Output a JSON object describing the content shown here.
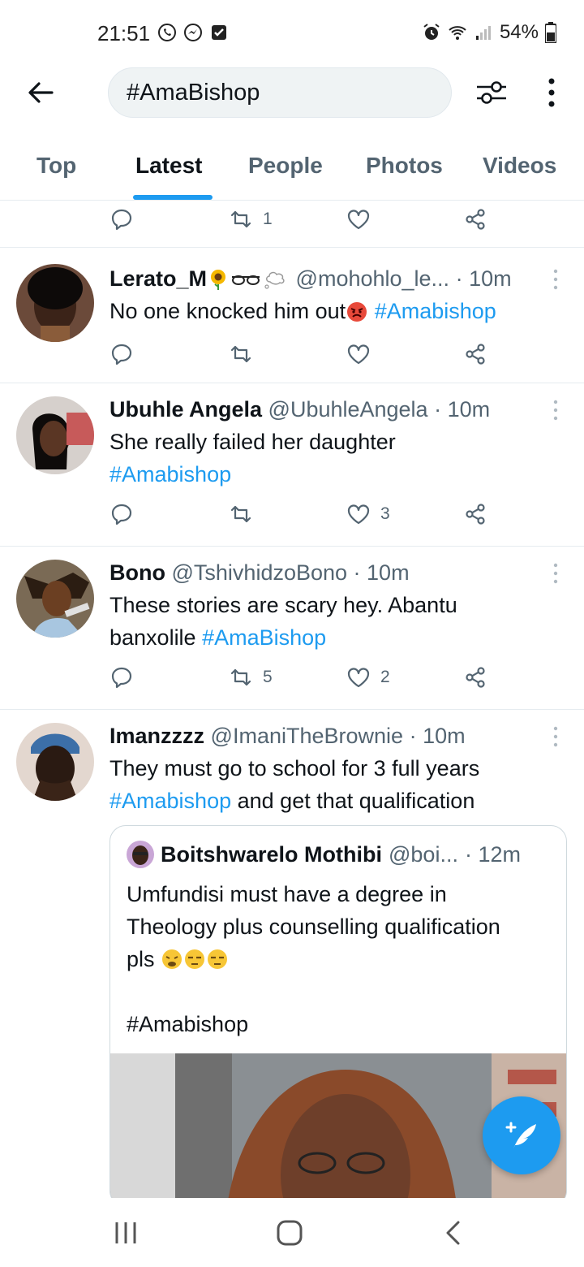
{
  "status_bar": {
    "time": "21:51",
    "battery": "54%"
  },
  "search": {
    "query": "#AmaBishop"
  },
  "tabs": [
    {
      "label": "Top"
    },
    {
      "label": "Latest"
    },
    {
      "label": "People"
    },
    {
      "label": "Photos"
    },
    {
      "label": "Videos"
    }
  ],
  "active_tab": "Latest",
  "top_partial_actions": {
    "retweets": "1"
  },
  "tweets": [
    {
      "name": "Lerato_M",
      "handle": "@mohohlo_le...",
      "time": "· 10m",
      "text": "No one knocked him out",
      "hashtag": "#Amabishop",
      "replies": "",
      "retweets": "",
      "likes": ""
    },
    {
      "name": "Ubuhle Angela",
      "handle": "@UbuhleAngela",
      "time": "· 10m",
      "text": "She really failed her daughter",
      "hashtag": "#Amabishop",
      "replies": "",
      "retweets": "",
      "likes": "3"
    },
    {
      "name": "Bono",
      "handle": "@TshivhidzoBono",
      "time": "· 10m",
      "text_line1": "These stories are scary hey. Abantu",
      "text_line2": "banxolile",
      "hashtag": "#AmaBishop",
      "replies": "",
      "retweets": "5",
      "likes": "2"
    },
    {
      "name": "Imanzzzz",
      "handle": "@ImaniTheBrownie",
      "time": "· 10m",
      "text_line1": "They must go to school for 3 full years",
      "hashtag": "#Amabishop",
      "text_line2": "and get that qualification",
      "quote": {
        "name": "Boitshwarelo Mothibi",
        "handle": "@boi...",
        "time": "· 12m",
        "text_line1": "Umfundisi must have a degree in",
        "text_line2": "Theology plus counselling qualification",
        "text_line3": "pls",
        "hashtag": "#Amabishop"
      }
    }
  ],
  "colors": {
    "accent": "#1d9bf0",
    "secondary_text": "#536471",
    "divider": "#e6ecf0"
  },
  "icons": [
    "back-arrow-icon",
    "filter-icon",
    "more-vertical-icon",
    "reply-icon",
    "retweet-icon",
    "like-icon",
    "share-icon",
    "compose-tweet-icon",
    "recent-apps-icon",
    "home-icon",
    "back-nav-icon"
  ]
}
